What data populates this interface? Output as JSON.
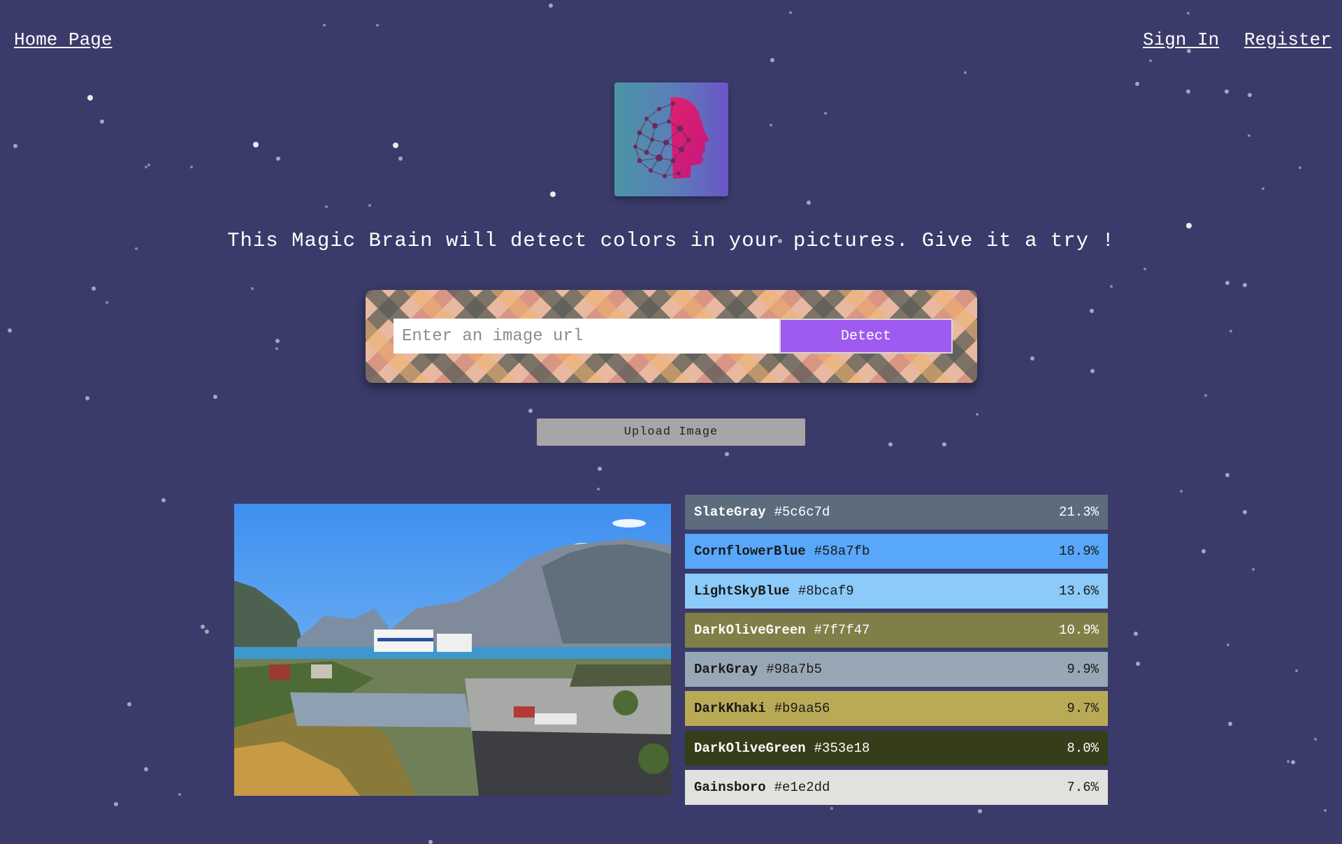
{
  "nav": {
    "home": "Home Page",
    "sign_in": "Sign In",
    "register": "Register"
  },
  "tagline": "This Magic Brain will detect colors in your pictures. Give it a try !",
  "form": {
    "placeholder": "Enter an image url",
    "detect": "Detect"
  },
  "upload": "Upload Image",
  "palette": [
    {
      "name": "SlateGray",
      "hex": "#5c6c7d",
      "percent": "21.3%",
      "text_color": "#ffffff"
    },
    {
      "name": "CornflowerBlue",
      "hex": "#58a7fb",
      "percent": "18.9%",
      "text_color": "#1a1a1a"
    },
    {
      "name": "LightSkyBlue",
      "hex": "#8bcaf9",
      "percent": "13.6%",
      "text_color": "#1a1a1a"
    },
    {
      "name": "DarkOliveGreen",
      "hex": "#7f7f47",
      "percent": "10.9%",
      "text_color": "#ffffff"
    },
    {
      "name": "DarkGray",
      "hex": "#98a7b5",
      "percent": "9.9%",
      "text_color": "#1a1a1a"
    },
    {
      "name": "DarkKhaki",
      "hex": "#b9aa56",
      "percent": "9.7%",
      "text_color": "#1a1a1a"
    },
    {
      "name": "DarkOliveGreen",
      "hex": "#353e18",
      "percent": "8.0%",
      "text_color": "#ffffff"
    },
    {
      "name": "Gainsboro",
      "hex": "#e1e2dd",
      "percent": "7.6%",
      "text_color": "#1a1a1a"
    }
  ],
  "colors": {
    "background": "#3a3b6a",
    "detect_button": "#9f5af0",
    "upload_button": "#a6a6a6"
  },
  "icons": {
    "logo": "brain-face-logo"
  }
}
